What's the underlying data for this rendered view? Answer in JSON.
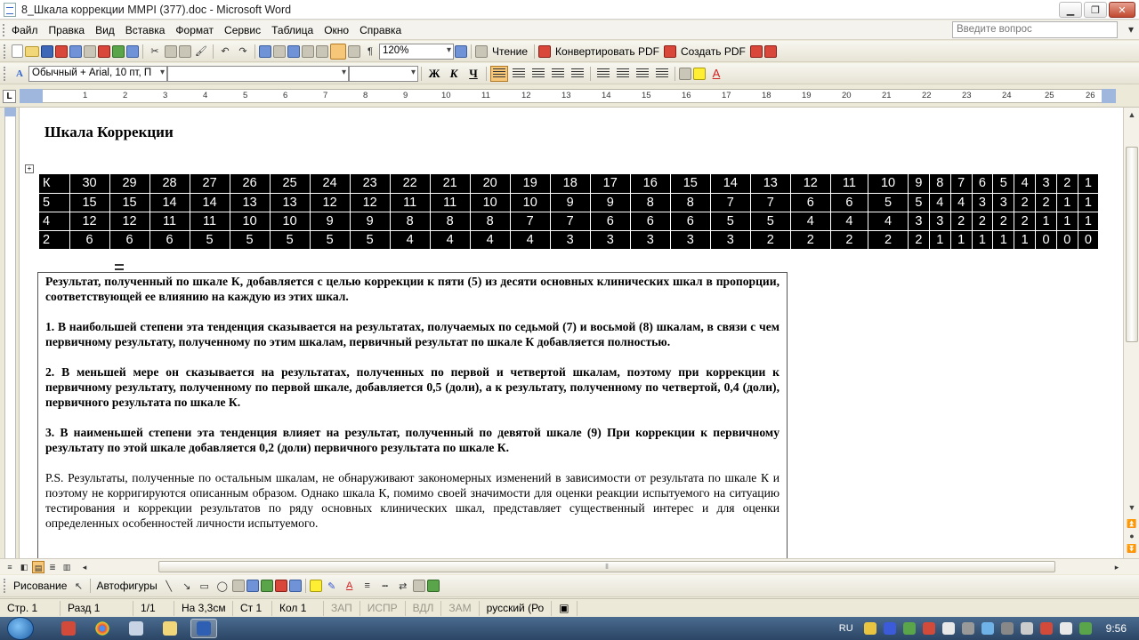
{
  "window": {
    "title": "8_Шкала коррекции MMPI (377).doc - Microsoft Word"
  },
  "menu": {
    "items": [
      "Файл",
      "Правка",
      "Вид",
      "Вставка",
      "Формат",
      "Сервис",
      "Таблица",
      "Окно",
      "Справка"
    ],
    "ask_placeholder": "Введите вопрос"
  },
  "toolbar_standard": {
    "zoom": "120%",
    "reading_label": "Чтение",
    "convert_pdf_label": "Конвертировать PDF",
    "create_pdf_label": "Создать PDF"
  },
  "toolbar_format": {
    "style": "Обычный + Arial, 10 пт, П",
    "font": "",
    "size": "",
    "bold": "Ж",
    "italic": "К",
    "underline": "Ч"
  },
  "ruler": {
    "unit_label": "L",
    "numbers": [
      "1",
      "2",
      "3",
      "4",
      "5",
      "6",
      "7",
      "8",
      "9",
      "10",
      "11",
      "12",
      "13",
      "14",
      "15",
      "16",
      "17",
      "18",
      "19",
      "20",
      "21",
      "22",
      "23",
      "24",
      "25",
      "26"
    ]
  },
  "document": {
    "heading": "Шкала Коррекции",
    "table": [
      [
        "К",
        "30",
        "29",
        "28",
        "27",
        "26",
        "25",
        "24",
        "23",
        "22",
        "21",
        "20",
        "19",
        "18",
        "17",
        "16",
        "15",
        "14",
        "13",
        "12",
        "11",
        "10",
        "9",
        "8",
        "7",
        "6",
        "5",
        "4",
        "3",
        "2",
        "1"
      ],
      [
        "5",
        "15",
        "15",
        "14",
        "14",
        "13",
        "13",
        "12",
        "12",
        "11",
        "11",
        "10",
        "10",
        "9",
        "9",
        "8",
        "8",
        "7",
        "7",
        "6",
        "6",
        "5",
        "5",
        "4",
        "4",
        "3",
        "3",
        "2",
        "2",
        "1",
        "1"
      ],
      [
        "4",
        "12",
        "12",
        "11",
        "11",
        "10",
        "10",
        "9",
        "9",
        "8",
        "8",
        "8",
        "7",
        "7",
        "6",
        "6",
        "6",
        "5",
        "5",
        "4",
        "4",
        "4",
        "3",
        "3",
        "2",
        "2",
        "2",
        "2",
        "1",
        "1",
        "1"
      ],
      [
        "2",
        "6",
        "6",
        "6",
        "5",
        "5",
        "5",
        "5",
        "5",
        "4",
        "4",
        "4",
        "4",
        "3",
        "3",
        "3",
        "3",
        "3",
        "2",
        "2",
        "2",
        "2",
        "2",
        "1",
        "1",
        "1",
        "1",
        "1",
        "0",
        "0",
        "0"
      ]
    ],
    "paragraphs": [
      "Результат, полученный по шкале К, добавляется с целью коррекции к пяти (5) из десяти основных клинических шкал в пропорции, соответствующей ее влиянию на каждую из этих шкал.",
      "1. В наибольшей степени эта тенденция сказывается на результатах, получаемых по седьмой (7) и восьмой (8) шкалам, в связи с чем первичному результату, полученному по этим шкалам, первичный результат по шкале К добавляется полностью.",
      "2. В меньшей мере он сказывается на результатах, полученных по первой и четвертой шкалам, поэтому при коррекции к первичному результату, полученному по первой шкале, добавляется 0,5 (доли), а к результату, полученному по четвертой, 0,4 (доли), первичного результата по шкале К.",
      "3. В наименьшей степени эта тенденция влияет на результат, полученный по девятой шкале (9) При коррекции к первичному результату по этой шкале добавляется 0,2 (доли) первичного результата по шкале К.",
      "P.S. Результаты, полученные по остальным шкалам, не обнаруживают закономерных изменений в зависимости от результата по шкале К и поэтому не корригируются описанным образом. Однако шкала К, помимо своей значимости для оценки реакции испытуемого на ситуацию тестирования и коррекции результатов по ряду основных клинических шкал, представляет существенный интерес и для оценки определенных особенностей личности испытуемого."
    ]
  },
  "drawing_toolbar": {
    "draw_label": "Рисование",
    "autoshapes_label": "Автофигуры"
  },
  "statusbar": {
    "page": "Стр. 1",
    "section": "Разд 1",
    "pages": "1/1",
    "position": "На 3,3см",
    "line": "Ст 1",
    "column": "Кол 1",
    "rec": "ЗАП",
    "trk": "ИСПР",
    "ext": "ВДЛ",
    "ovr": "ЗАМ",
    "language": "русский (Ро"
  },
  "taskbar": {
    "lang": "RU",
    "clock": "9:56"
  }
}
